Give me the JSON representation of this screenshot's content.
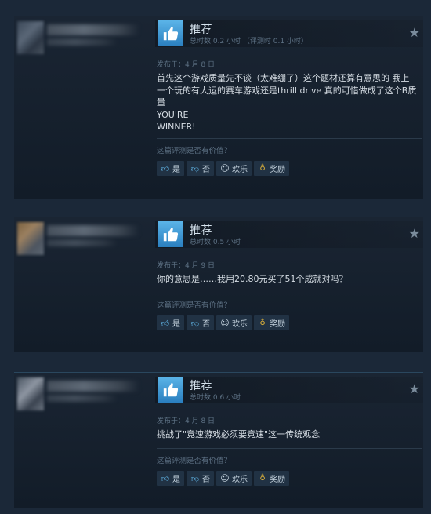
{
  "reviews": [
    {
      "vote_title": "推荐",
      "hours": "总时数 0.2 小时 （评测时 0.1 小时）",
      "posted": "发布于：4 月 8 日",
      "text": "首先这个游戏质量先不谈（太难绷了）这个题材还算有意思的 我上\n一个玩的有大运的赛车游戏还是thrill drive 真的可惜做成了这个B质\n量\nYOU'RE\nWINNER!",
      "helpful_prompt": "这篇评测是否有价值？",
      "buttons": {
        "yes": "是",
        "no": "否",
        "funny": "欢乐",
        "award": "奖励"
      }
    },
    {
      "vote_title": "推荐",
      "hours": "总时数 0.5 小时",
      "posted": "发布于：4 月 9 日",
      "text": "你的意思是……我用20.80元买了51个成就对吗？",
      "helpful_prompt": "这篇评测是否有价值？",
      "buttons": {
        "yes": "是",
        "no": "否",
        "funny": "欢乐",
        "award": "奖励"
      }
    },
    {
      "vote_title": "推荐",
      "hours": "总时数 0.6 小时",
      "posted": "发布于：4 月 8 日",
      "text": "挑战了\"竞速游戏必须要竞速\"这一传统观念",
      "helpful_prompt": "这篇评测是否有价值？",
      "buttons": {
        "yes": "是",
        "no": "否",
        "funny": "欢乐",
        "award": "奖励"
      }
    }
  ],
  "icons": {
    "thumb": "thumbs-up-icon",
    "star": "star-icon",
    "yes": "thumbs-up-icon",
    "no": "thumbs-down-icon",
    "funny": "smiley-icon",
    "award": "award-icon"
  },
  "colors": {
    "background": "#1b2838",
    "accent": "#66c0f4",
    "thumb_box": "#3d8fd1"
  }
}
